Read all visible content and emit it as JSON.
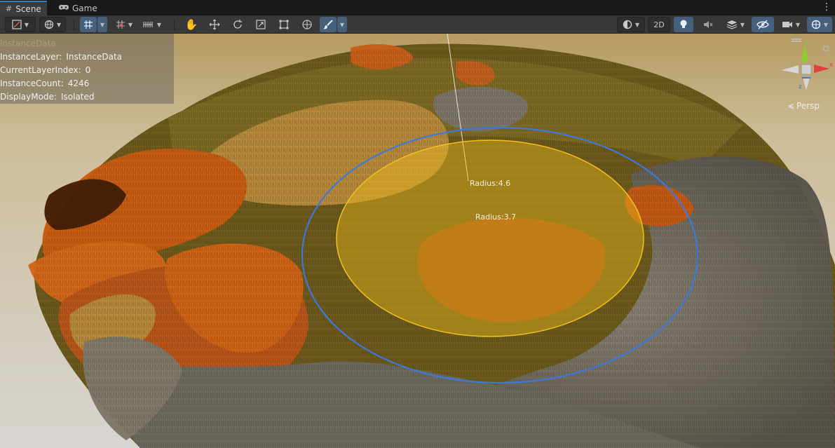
{
  "tabs": [
    {
      "label": "Scene",
      "icon": "scene-grid-icon",
      "active": true
    },
    {
      "label": "Game",
      "icon": "gamepad-icon",
      "active": false
    }
  ],
  "toolbar": {
    "mode_2d_label": "2D"
  },
  "overlay": {
    "rows": [
      {
        "text": "InstanceData"
      },
      {
        "key": "InstanceLayer:",
        "value": "InstanceData"
      },
      {
        "key": "CurrentLayerIndex:",
        "value": "0"
      },
      {
        "key": "InstanceCount:",
        "value": "4246"
      },
      {
        "key": "DisplayMode:",
        "value": "Isolated"
      }
    ]
  },
  "brush": {
    "outer_radius_label": "Radius:4.6",
    "inner_radius_label": "Radius:3.7",
    "outer_color": "#3f79d8",
    "inner_color": "#f2c21a"
  },
  "view": {
    "projection_label": "Persp",
    "axis_labels": {
      "y": "y",
      "x": "x",
      "z": "z"
    }
  },
  "colors": {
    "accent": "#3a79bb",
    "toolbar_bg": "#383838",
    "tab_bg": "#191919"
  }
}
